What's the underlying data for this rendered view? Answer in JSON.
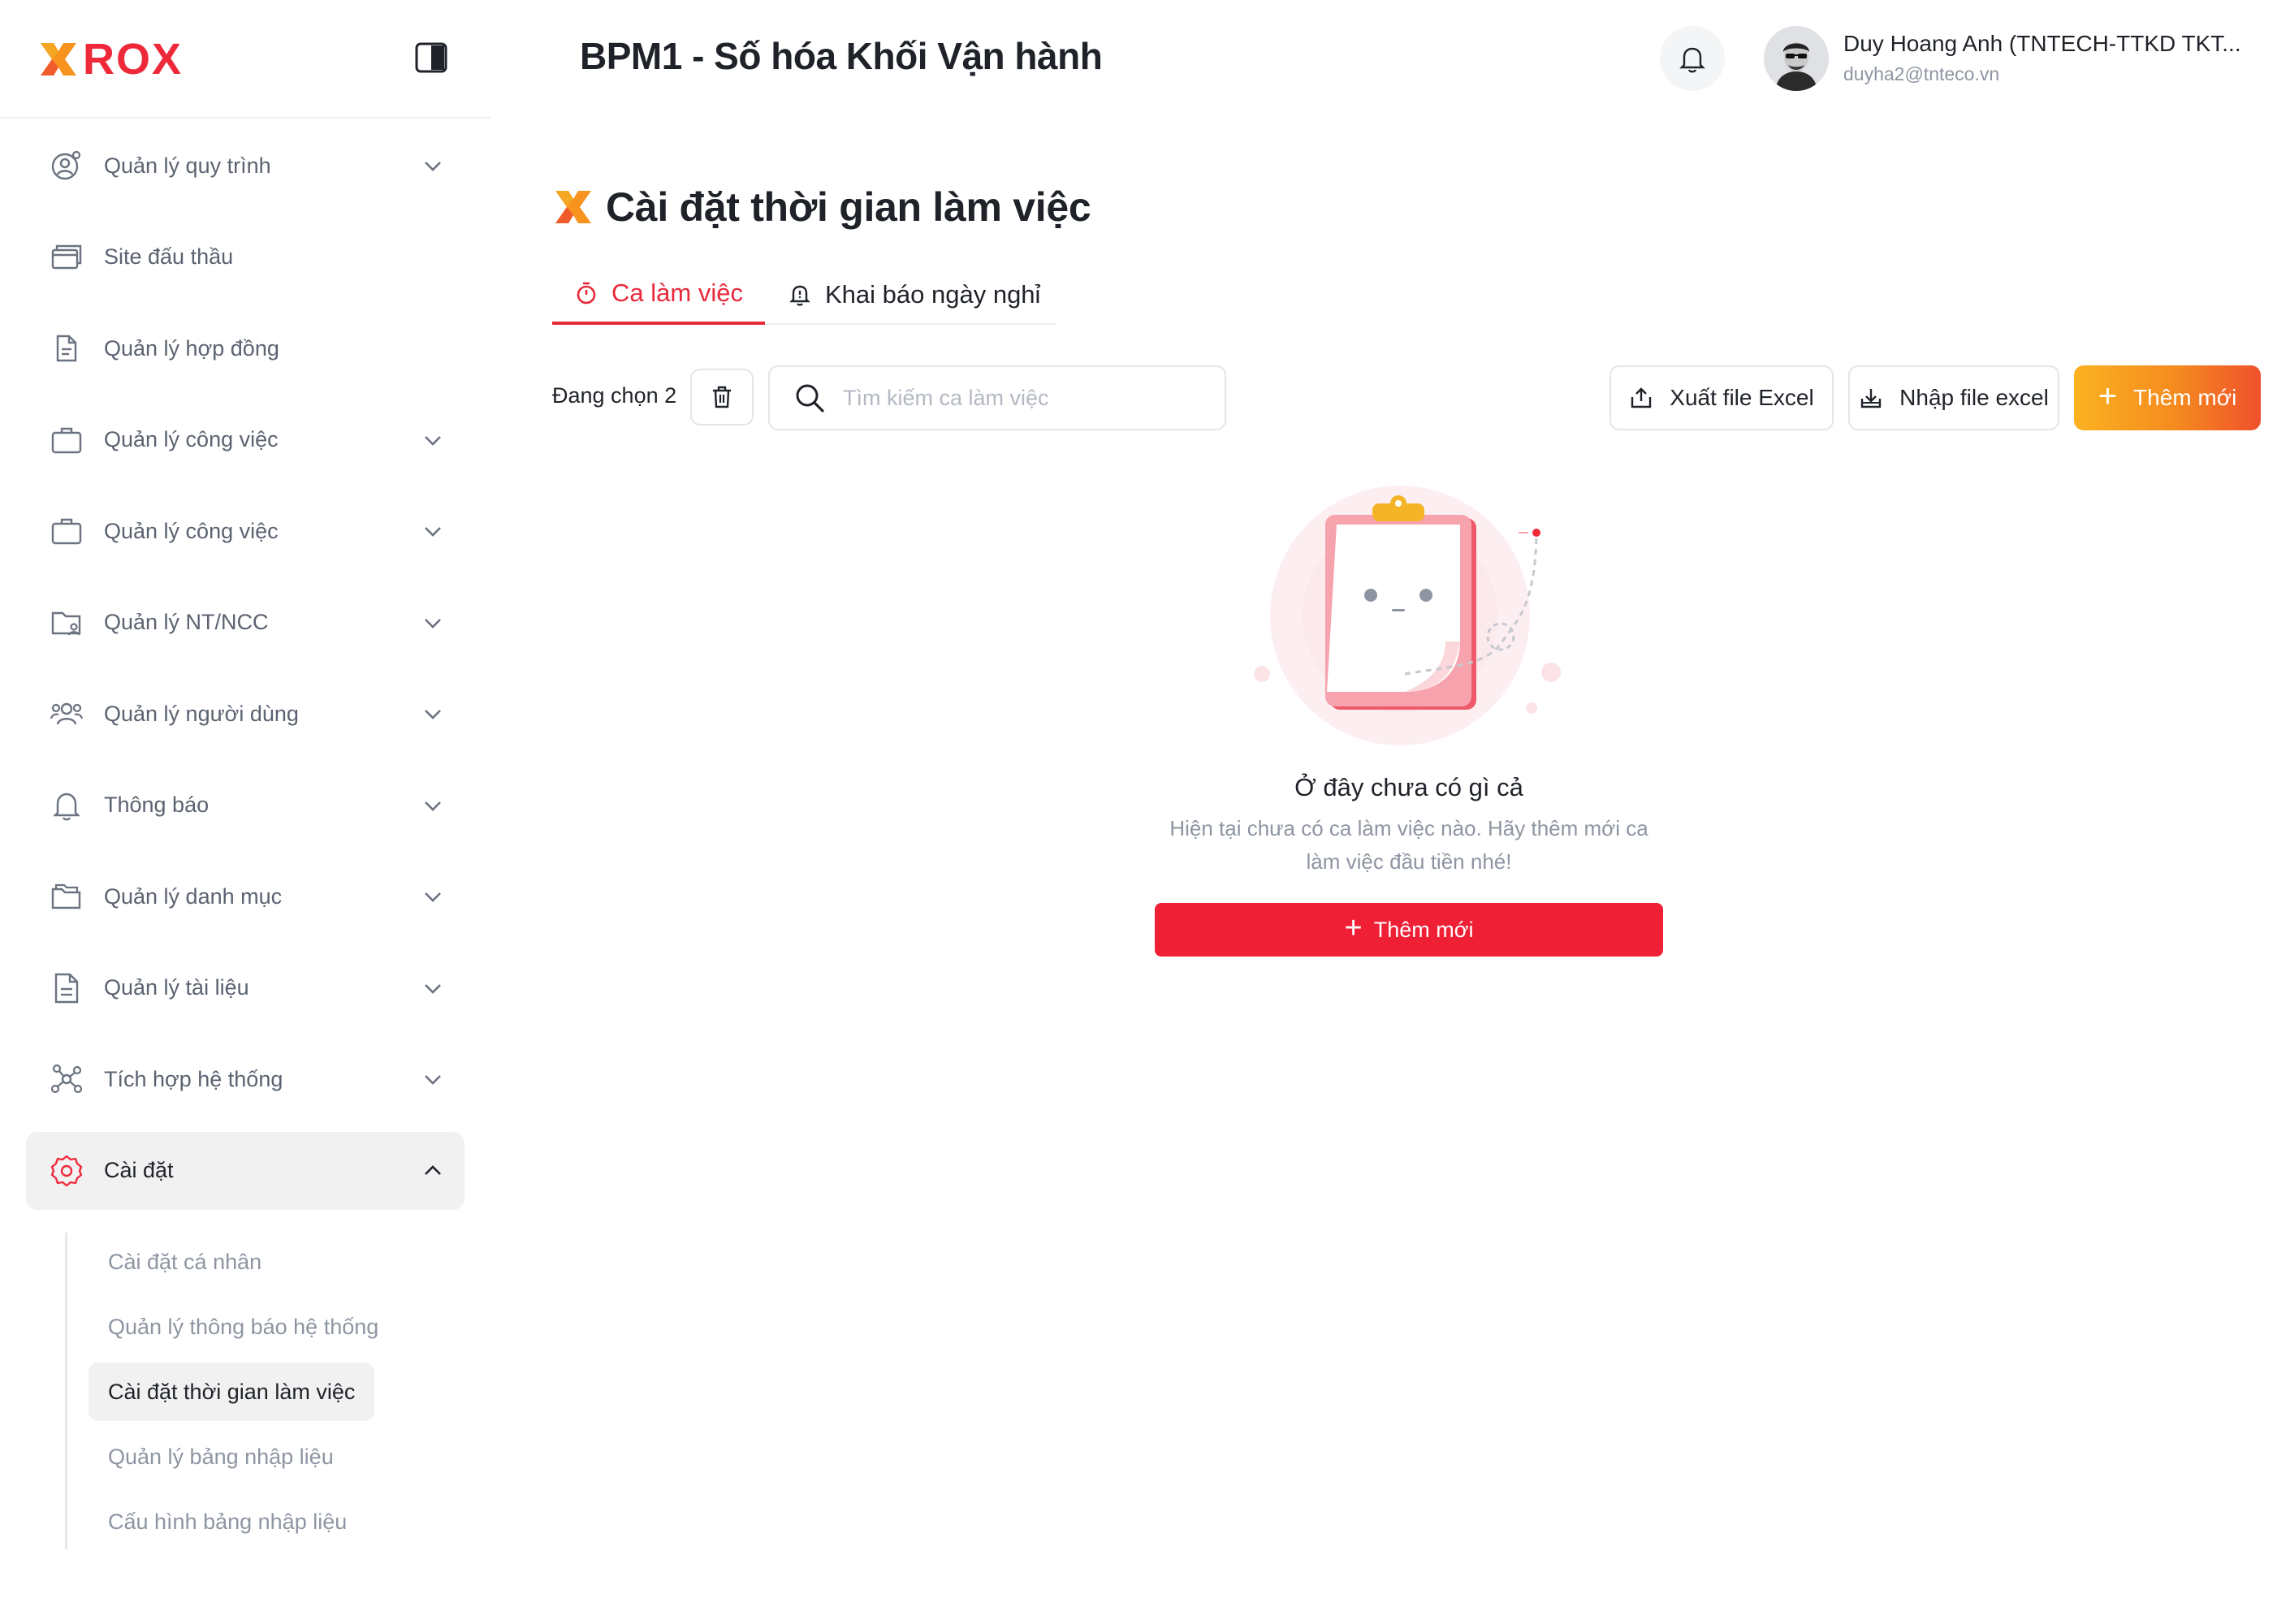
{
  "brand": {
    "name": "ROX",
    "accent_color": "#ee2a3a",
    "orange_color": "#f58a1f"
  },
  "header": {
    "title": "BPM1 - Số hóa Khối Vận hành",
    "user": {
      "name": "Duy Hoang Anh (TNTECH-TTKD TKT...",
      "email": "duyha2@tnteco.vn"
    }
  },
  "sidebar": {
    "items": [
      {
        "label": "Quản lý quy trình",
        "icon": "user-gear-icon",
        "has_chevron": true
      },
      {
        "label": "Site đấu thầu",
        "icon": "browser-windows-icon",
        "has_chevron": false
      },
      {
        "label": "Quản lý hợp đồng",
        "icon": "document-copy-icon",
        "has_chevron": false
      },
      {
        "label": "Quản lý công việc",
        "icon": "briefcase-icon",
        "has_chevron": true
      },
      {
        "label": "Quản lý công việc",
        "icon": "briefcase-icon",
        "has_chevron": true
      },
      {
        "label": "Quản lý NT/NCC",
        "icon": "folder-user-icon",
        "has_chevron": true
      },
      {
        "label": "Quản lý người dùng",
        "icon": "users-icon",
        "has_chevron": true
      },
      {
        "label": "Thông báo",
        "icon": "bell-icon",
        "has_chevron": true
      },
      {
        "label": "Quản lý danh mục",
        "icon": "folders-icon",
        "has_chevron": true
      },
      {
        "label": "Quản lý tài liệu",
        "icon": "document-icon",
        "has_chevron": true
      },
      {
        "label": "Tích hợp hệ thống",
        "icon": "network-icon",
        "has_chevron": true
      },
      {
        "label": "Cài đặt",
        "icon": "settings-icon",
        "has_chevron": true,
        "expanded": true
      }
    ],
    "settings_submenu": [
      {
        "label": "Cài đặt cá nhân"
      },
      {
        "label": "Quản lý thông báo hệ thống"
      },
      {
        "label": "Cài đặt thời gian làm việc",
        "active": true
      },
      {
        "label": "Quản lý bảng nhập liệu"
      },
      {
        "label": "Cấu hình bảng nhập liệu"
      }
    ]
  },
  "page": {
    "title": "Cài đặt thời gian làm việc",
    "tabs": [
      {
        "label": "Ca làm việc",
        "icon": "timer-icon",
        "active": true
      },
      {
        "label": "Khai báo ngày nghỉ",
        "icon": "bell-alert-icon",
        "active": false
      }
    ]
  },
  "toolbar": {
    "selected_label": "Đang chọn 2",
    "search_placeholder": "Tìm kiếm ca làm việc",
    "export_label": "Xuất file Excel",
    "import_label": "Nhập file excel",
    "add_label": "Thêm mới"
  },
  "empty_state": {
    "title": "Ở đây chưa có gì cả",
    "description": "Hiện tại chưa có ca làm việc nào. Hãy thêm mới ca làm việc đầu tiền nhé!",
    "button_label": "Thêm mới"
  }
}
